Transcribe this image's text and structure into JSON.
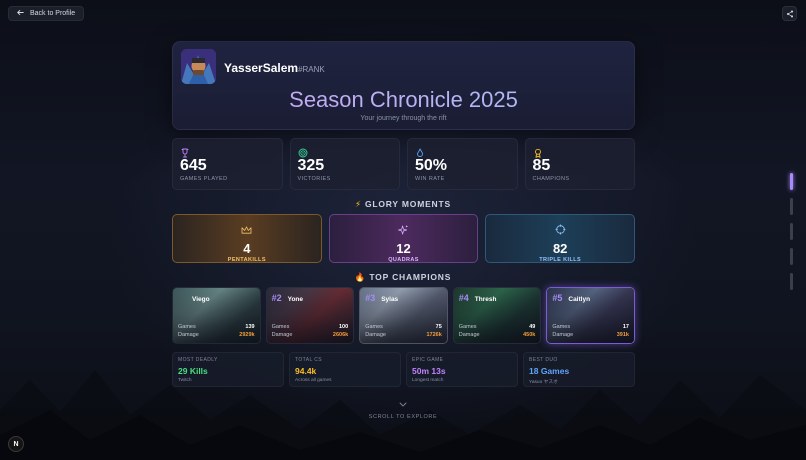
{
  "nav": {
    "back_label": "Back to Profile"
  },
  "profile": {
    "name": "YasserSalem",
    "tag": "#RANK",
    "season_title": "Season Chronicle 2025",
    "subtitle": "Your journey through the rift"
  },
  "stats": [
    {
      "value": "645",
      "label": "GAMES PLAYED",
      "icon": "trophy-icon",
      "color": "#c084fc"
    },
    {
      "value": "325",
      "label": "VICTORIES",
      "icon": "target-icon",
      "color": "#34d399"
    },
    {
      "value": "50%",
      "label": "WIN RATE",
      "icon": "flame-icon",
      "color": "#60a5fa"
    },
    {
      "value": "85",
      "label": "CHAMPIONS",
      "icon": "medal-icon",
      "color": "#fbbf24"
    }
  ],
  "glory": {
    "title": "GLORY MOMENTS",
    "items": [
      {
        "value": "4",
        "label": "PENTAKILLS",
        "icon": "crown-icon"
      },
      {
        "value": "12",
        "label": "QUADRAS",
        "icon": "sparkles-icon"
      },
      {
        "value": "82",
        "label": "TRIPLE KILLS",
        "icon": "crosshair-icon"
      }
    ]
  },
  "top_champions": {
    "title": "TOP CHAMPIONS",
    "games_label": "Games",
    "damage_label": "Damage",
    "items": [
      {
        "rank": "",
        "name": "Viego",
        "games": "139",
        "damage": "2929k"
      },
      {
        "rank": "#2",
        "name": "Yone",
        "games": "100",
        "damage": "2606k"
      },
      {
        "rank": "#3",
        "name": "Sylas",
        "games": "75",
        "damage": "1726k"
      },
      {
        "rank": "#4",
        "name": "Thresh",
        "games": "49",
        "damage": "450k"
      },
      {
        "rank": "#5",
        "name": "Caitlyn",
        "games": "17",
        "damage": "391k"
      }
    ]
  },
  "records": [
    {
      "title": "MOST DEADLY",
      "value": "29 Kills",
      "sub": "Twitch",
      "color": "#4ade80"
    },
    {
      "title": "TOTAL CS",
      "value": "94.4k",
      "sub": "Across all games",
      "color": "#fbbf24"
    },
    {
      "title": "EPIC GAME",
      "value": "50m 13s",
      "sub": "Longest match",
      "color": "#c084fc"
    },
    {
      "title": "BEST DUO",
      "value": "18 Games",
      "sub": "Yasuo ヤスオ",
      "color": "#60a5fa"
    }
  ],
  "scroll_hint": "SCROLL TO EXPLORE",
  "badge": "N"
}
